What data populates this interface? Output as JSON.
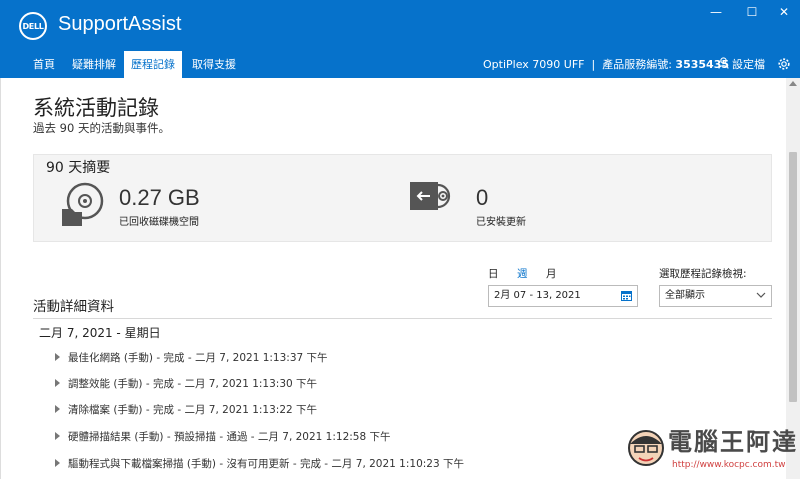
{
  "app": {
    "logo_text": "DELL",
    "title": "SupportAssist"
  },
  "window_controls": {
    "minimize": "—",
    "maximize": "☐",
    "close": "✕"
  },
  "nav": {
    "tabs": [
      {
        "label": "首頁"
      },
      {
        "label": "疑難排解"
      },
      {
        "label": "歷程記錄"
      },
      {
        "label": "取得支援"
      }
    ],
    "active_tab": "歷程記錄",
    "device_model": "OptiPlex 7090 UFF",
    "separator": "|",
    "service_tag_label": "產品服務編號:",
    "service_tag": "3535435",
    "settings_label": "設定檔"
  },
  "page": {
    "title": "系統活動記錄",
    "subtitle": "過去 90 天的活動與事件。"
  },
  "summary": {
    "title": "90 天摘要",
    "stats": [
      {
        "value": "0.27 GB",
        "label": "已回收磁碟機空間",
        "icon": "disk-cleanup-icon"
      },
      {
        "value": "0",
        "label": "已安裝更新",
        "icon": "driver-update-icon"
      }
    ]
  },
  "filters": {
    "periods": [
      "日",
      "週",
      "月"
    ],
    "active_period": "週",
    "date_range": "2月 07 - 13, 2021",
    "view_label": "選取歷程記錄檢視:",
    "view_value": "全部顯示"
  },
  "details": {
    "title": "活動詳細資料",
    "date_header": "二月 7, 2021 - 星期日",
    "events": [
      "最佳化網路 (手動) - 完成 - 二月 7, 2021 1:13:37 下午",
      "調整效能 (手動) - 完成 - 二月 7, 2021 1:13:30 下午",
      "清除檔案 (手動) - 完成 - 二月 7, 2021 1:13:22 下午",
      "硬體掃描結果 (手動) - 預設掃描 - 通過 - 二月 7, 2021 1:12:58 下午",
      "驅動程式與下載檔案掃描 (手動) - 沒有可用更新 - 完成 - 二月 7, 2021 1:10:23 下午"
    ]
  },
  "watermark": {
    "text": "電腦王阿達",
    "url": "http://www.kocpc.com.tw"
  },
  "colors": {
    "brand": "#0672cb",
    "summary_bg": "#f4f4f4"
  }
}
